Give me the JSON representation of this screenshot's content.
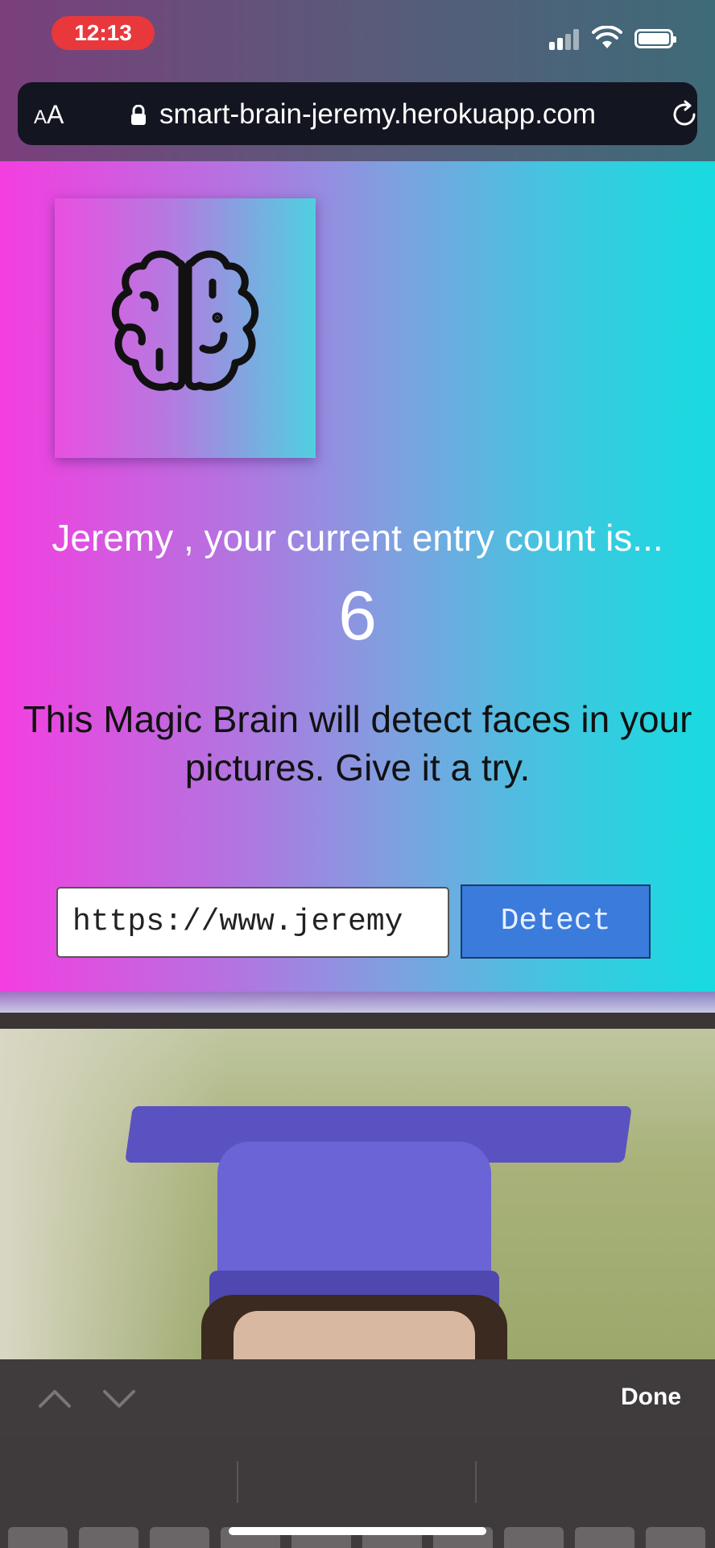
{
  "status_bar": {
    "time": "12:13",
    "icons": [
      "cellular-signal-icon",
      "wifi-icon",
      "battery-icon"
    ]
  },
  "browser": {
    "text_size_label_small": "A",
    "text_size_label_large": "A",
    "url": "smart-brain-jeremy.herokuapp.com",
    "icons": [
      "lock-icon",
      "reload-icon"
    ]
  },
  "app": {
    "logo_icon": "brain-icon",
    "entry_message": "Jeremy , your current entry count is...",
    "entry_count": "6",
    "description": "This Magic Brain will detect faces in your pictures. Give it a try.",
    "url_input_value": "https://www.jeremy",
    "detect_label": "Detect",
    "colors": {
      "gradient_left": "#f43ee0",
      "gradient_right": "#17dbe0",
      "detect_button": "#3b7bdb"
    }
  },
  "keyboard_toolbar": {
    "done_label": "Done",
    "icons": [
      "chevron-up-icon",
      "chevron-down-icon"
    ]
  }
}
